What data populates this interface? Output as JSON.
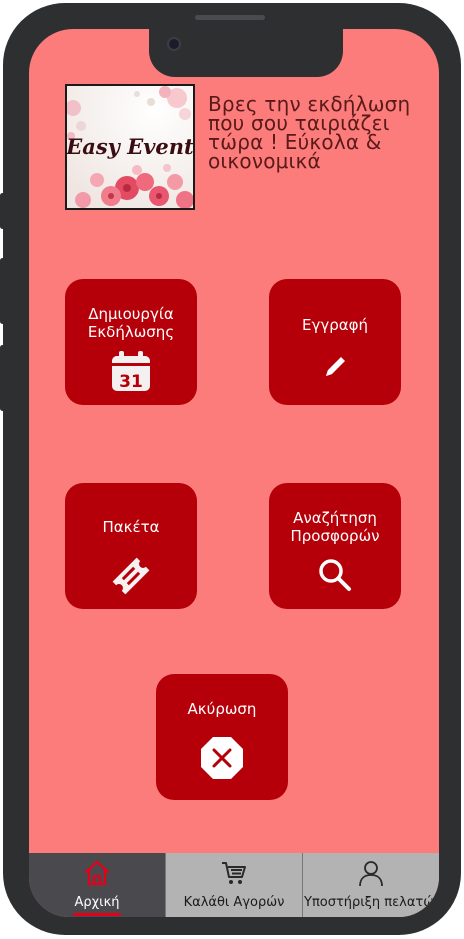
{
  "header": {
    "logo_text": "Easy Event",
    "tagline": "Βρες την εκδήλωση που σου ταιριάζει τώρα ! Εύκολα & οικονομικά"
  },
  "tiles": {
    "create_event": {
      "label": "Δημιουργία Εκδήλωσης",
      "icon": "calendar-icon",
      "calendar_day": "31"
    },
    "register": {
      "label": "Εγγραφή",
      "icon": "pencil-icon"
    },
    "packages": {
      "label": "Πακέτα",
      "icon": "ticket-icon"
    },
    "search_offers": {
      "label": "Αναζήτηση Προσφορών",
      "icon": "search-icon"
    },
    "cancel": {
      "label": "Ακύρωση",
      "icon": "cancel-octagon-icon"
    }
  },
  "bottom_nav": {
    "home": {
      "label": "Αρχική",
      "icon": "home-icon",
      "active": true
    },
    "cart": {
      "label": "Καλάθι Αγορών",
      "icon": "cart-icon"
    },
    "support": {
      "label": "Υποστήριξη πελατών",
      "icon": "user-icon"
    }
  },
  "colors": {
    "screen_background": "#fc7b7b",
    "tile_background": "#b50009",
    "nav_active": "#4a4a4e",
    "nav_inactive": "#b3b3b3",
    "active_underline": "#e5001a"
  }
}
